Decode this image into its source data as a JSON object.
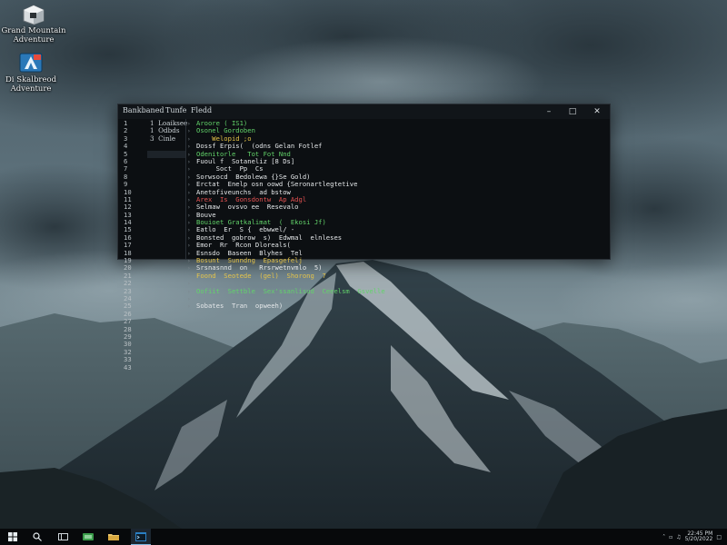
{
  "desktop": {
    "icons": [
      {
        "id": "game",
        "label": "Grand Mountain\nAdventure",
        "icon": "cube-icon"
      },
      {
        "id": "app2",
        "label": "Di Skalbreod\nAdventure",
        "icon": "app-icon"
      }
    ]
  },
  "terminal": {
    "menu": [
      "Bankbaned",
      "Tunfe",
      "Fledd"
    ],
    "window_buttons": [
      "minimize-icon",
      "maximize-icon",
      "close-icon"
    ],
    "line_numbers": [
      "1",
      "2",
      "3",
      "4",
      "5",
      "6",
      "7",
      "8",
      "9",
      "10",
      "11",
      "12",
      "13",
      "14",
      "15",
      "16",
      "17",
      "18",
      "19",
      "20",
      "21",
      "22",
      "23",
      "24",
      "25",
      "26",
      "27",
      "28",
      "29",
      "30",
      "32",
      "33",
      "43"
    ],
    "sidebar_items": [
      "1  Loaiksee",
      "1  Odbds",
      "3  Cinle",
      "",
      ""
    ],
    "sidebar_selected_index": 4,
    "lines": [
      {
        "text": "Aroore ( IS1)",
        "color": "#62d36a"
      },
      {
        "text": "Osonel Gordoben",
        "color": "#62d36a"
      },
      {
        "text": "    Welopid ;o",
        "color": "#e5c449"
      },
      {
        "text": "Dossf Erpis(  (odns Gelan Fotlef",
        "color": "#e4e7e9"
      },
      {
        "text": "Odenitorle   Tot Fot Nnd",
        "color": "#62d36a"
      },
      {
        "text": "Fuoul f  Sotaneliz [8 Ds]",
        "color": "#e4e7e9"
      },
      {
        "text": "     Soct  Pp  Cs",
        "color": "#e4e7e9"
      },
      {
        "text": "Sorwsocd  Bedolewa {}Se Gold)",
        "color": "#e4e7e9"
      },
      {
        "text": "Erctat  Enelp osn oowd {Seronartlegtetive",
        "color": "#e4e7e9"
      },
      {
        "text": "Anetofiveunchs  ad bstow",
        "color": "#e4e7e9"
      },
      {
        "text": "Arex  Is  Gonsdontw  Ap Adgl",
        "color": "#e55252"
      },
      {
        "text": "Selmaw  ovsvo ee  Resevalo",
        "color": "#e4e7e9"
      },
      {
        "text": "Bouve",
        "color": "#e4e7e9"
      },
      {
        "text": "Bouioet Gratkalimat  (  Ekosi Jf)",
        "color": "#62d36a"
      },
      {
        "text": "Eatlo  Er  S {  ebwwel/ -",
        "color": "#e4e7e9"
      },
      {
        "text": "Bonsted  gobrow  s)  Edwmal  elnleses",
        "color": "#e4e7e9"
      },
      {
        "text": "Emor  Rr  Rcon Dloreals(",
        "color": "#e4e7e9"
      },
      {
        "text": "Esnsdo  Baseen  Blyhes  Tel",
        "color": "#e4e7e9"
      },
      {
        "text": "Bosunt  Sunndng  Epasgefelj",
        "color": "#e5c449"
      },
      {
        "text": "Srsnasnnd  on   Rrsrwetnvmlo  5)",
        "color": "#e4e7e9"
      },
      {
        "text": "Foond  Seotede  (gel)  Shorong  7",
        "color": "#e5c449"
      },
      {
        "text": "",
        "color": "#e4e7e9"
      },
      {
        "text": "Oofiit  Settble  Sex'ssanlisud  Ceeelsm  Gsvelle",
        "color": "#62d36a"
      },
      {
        "text": "",
        "color": "#e4e7e9"
      },
      {
        "text": "Sobates  Tran  opweeh)",
        "color": "#e4e7e9"
      }
    ]
  },
  "taskbar": {
    "buttons": [
      {
        "id": "start",
        "icon": "windows-logo-icon",
        "active": false
      },
      {
        "id": "search",
        "icon": "search-icon",
        "active": false
      },
      {
        "id": "taskview",
        "icon": "task-view-icon",
        "active": false
      },
      {
        "id": "edge",
        "icon": "edge-icon",
        "active": false
      },
      {
        "id": "explorer",
        "icon": "folder-icon",
        "active": false
      },
      {
        "id": "store",
        "icon": "store-icon",
        "active": false
      },
      {
        "id": "terminal",
        "icon": "terminal-icon",
        "active": true
      }
    ],
    "tray": {
      "time": "22:45 PM",
      "date": "5/20/2022"
    }
  },
  "colors": {
    "accent": "#7fb7e0",
    "terminal_bg": "#0c0f12"
  }
}
